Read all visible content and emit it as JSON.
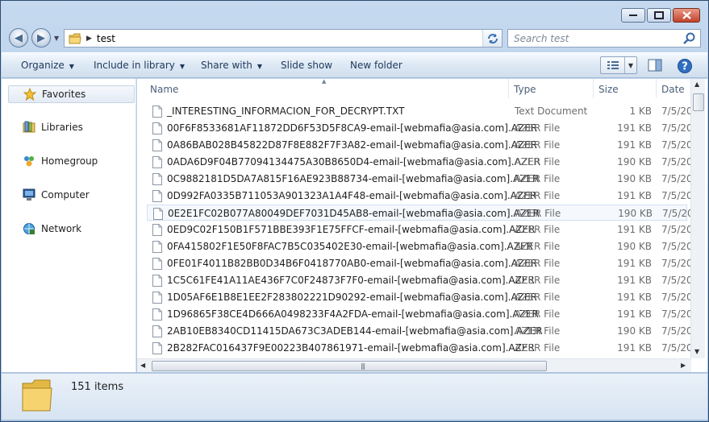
{
  "window": {
    "caption_buttons": [
      "minimize",
      "maximize",
      "close"
    ]
  },
  "address": {
    "crumb": "test"
  },
  "search": {
    "placeholder": "Search test"
  },
  "toolbar": {
    "organize": "Organize",
    "include": "Include in library",
    "share": "Share with",
    "slideshow": "Slide show",
    "newfolder": "New folder"
  },
  "sidebar": {
    "favorites": "Favorites",
    "libraries": "Libraries",
    "homegroup": "Homegroup",
    "computer": "Computer",
    "network": "Network"
  },
  "columns": {
    "name": "Name",
    "type": "Type",
    "size": "Size",
    "date": "Date"
  },
  "files": [
    {
      "name": "_INTERESTING_INFORMACION_FOR_DECRYPT.TXT",
      "type": "Text Document",
      "size": "1 KB",
      "date": "7/5/20"
    },
    {
      "name": "00F6F8533681AF11872DD6F53D5F8CA9-email-[webmafia@asia.com].AZER",
      "type": "AZER File",
      "size": "191 KB",
      "date": "7/5/20"
    },
    {
      "name": "0A86BAB028B45822D87F8E882F7F3A82-email-[webmafia@asia.com].AZER",
      "type": "AZER File",
      "size": "191 KB",
      "date": "7/5/20"
    },
    {
      "name": "0ADA6D9F04B77094134475A30B8650D4-email-[webmafia@asia.com].AZER",
      "type": "AZER File",
      "size": "190 KB",
      "date": "7/5/20"
    },
    {
      "name": "0C9882181D5DA7A815F16AE923B88734-email-[webmafia@asia.com].AZER",
      "type": "AZER File",
      "size": "190 KB",
      "date": "7/5/20"
    },
    {
      "name": "0D992FA0335B711053A901323A1A4F48-email-[webmafia@asia.com].AZER",
      "type": "AZER File",
      "size": "191 KB",
      "date": "7/5/20"
    },
    {
      "name": "0E2E1FC02B077A80049DEF7031D45AB8-email-[webmafia@asia.com].AZER",
      "type": "AZER File",
      "size": "190 KB",
      "date": "7/5/20"
    },
    {
      "name": "0ED9C02F150B1F571BBE393F1E75FFCF-email-[webmafia@asia.com].AZER",
      "type": "AZER File",
      "size": "191 KB",
      "date": "7/5/20"
    },
    {
      "name": "0FA415802F1E50F8FAC7B5C035402E30-email-[webmafia@asia.com].AZER",
      "type": "AZER File",
      "size": "190 KB",
      "date": "7/5/20"
    },
    {
      "name": "0FE01F4011B82BB0D34B6F0418770AB0-email-[webmafia@asia.com].AZER",
      "type": "AZER File",
      "size": "191 KB",
      "date": "7/5/20"
    },
    {
      "name": "1C5C61FE41A11AE436F7C0F24873F7F0-email-[webmafia@asia.com].AZER",
      "type": "AZER File",
      "size": "191 KB",
      "date": "7/5/20"
    },
    {
      "name": "1D05AF6E1B8E1EE2F283802221D90292-email-[webmafia@asia.com].AZER",
      "type": "AZER File",
      "size": "191 KB",
      "date": "7/5/20"
    },
    {
      "name": "1D96865F38CE4D666A0498233F4A2FDA-email-[webmafia@asia.com].AZER",
      "type": "AZER File",
      "size": "191 KB",
      "date": "7/5/20"
    },
    {
      "name": "2AB10EB8340CD11415DA673C3ADEB144-email-[webmafia@asia.com].AZER",
      "type": "AZER File",
      "size": "190 KB",
      "date": "7/5/20"
    },
    {
      "name": "2B282FAC016437F9E00223B407861971-email-[webmafia@asia.com].AZER",
      "type": "AZER File",
      "size": "191 KB",
      "date": "7/5/20"
    }
  ],
  "details": {
    "count": "151 items"
  },
  "colors": {
    "frame": "#b7cde6",
    "toolbar_text": "#1e395b",
    "selected_row_border": "#d0dff1"
  }
}
